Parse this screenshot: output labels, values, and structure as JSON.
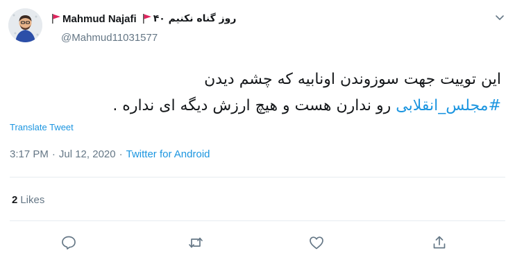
{
  "user": {
    "display_name": "Mahmud Najafi",
    "name_suffix": "روز گناه نکنیم ۴۰",
    "handle": "@Mahmud11031577",
    "avatar": "avatar-icon",
    "flag_icon": "red-flag-icon"
  },
  "tweet": {
    "line1": "این توییت جهت سوزوندن اونابیه که چشم دیدن",
    "hashtag": "#مجلس_انقلابی",
    "line2_rest": " رو ندارن هست و هیچ ارزش دیگه ای نداره .",
    "translate_label": "Translate Tweet"
  },
  "meta": {
    "time": "3:17 PM",
    "separator": "·",
    "date": "Jul 12, 2020",
    "source": "Twitter for Android"
  },
  "stats": {
    "likes_count": "2",
    "likes_label": "Likes"
  },
  "actions": {
    "reply": "reply-icon",
    "retweet": "retweet-icon",
    "like": "heart-icon",
    "share": "share-icon"
  },
  "colors": {
    "link": "#1b95e0",
    "secondary_text": "#657786",
    "divider": "#e6ecf0",
    "flag": "#e0245e"
  }
}
